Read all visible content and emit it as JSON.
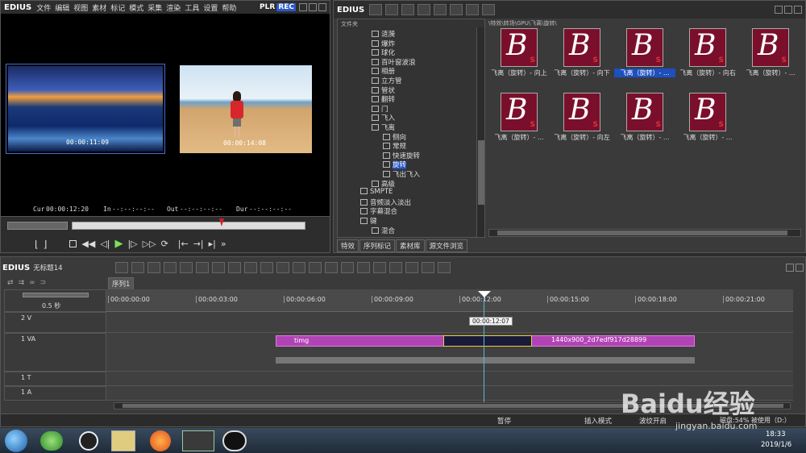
{
  "player": {
    "logo": "EDIUS",
    "menu": [
      "文件",
      "编辑",
      "视图",
      "素材",
      "标记",
      "模式",
      "采集",
      "渲染",
      "工具",
      "设置",
      "帮助"
    ],
    "plr": "PLR",
    "rec": "REC",
    "clip1_tc": "00:00:11:09",
    "clip2_tc": "00:00:14:08",
    "cur_label": "Cur",
    "cur_value": "00:00:12:20",
    "in_label": "In",
    "in_value": "--:--:--:--",
    "out_label": "Out",
    "out_value": "--:--:--:--",
    "dur_label": "Dur",
    "dur_value": "--:--:--:--"
  },
  "bin": {
    "logo": "EDIUS",
    "folder_header": "文件夹",
    "path": "\\特效\\转场\\GPU\\飞离\\旋转\\",
    "tree": [
      {
        "label": "涟漪",
        "indent": 1
      },
      {
        "label": "爆炸",
        "indent": 1
      },
      {
        "label": "球化",
        "indent": 1
      },
      {
        "label": "百叶窗波浪",
        "indent": 1
      },
      {
        "label": "相册",
        "indent": 1
      },
      {
        "label": "立方管",
        "indent": 1
      },
      {
        "label": "管状",
        "indent": 1
      },
      {
        "label": "翻转",
        "indent": 1
      },
      {
        "label": "门",
        "indent": 1
      },
      {
        "label": "飞入",
        "indent": 1
      },
      {
        "label": "飞离",
        "indent": 1
      },
      {
        "label": "侧向",
        "indent": 2
      },
      {
        "label": "常规",
        "indent": 2
      },
      {
        "label": "快速旋转",
        "indent": 2
      },
      {
        "label": "旋转",
        "indent": 2
      },
      {
        "label": "飞出飞入",
        "indent": 2
      },
      {
        "label": "高级",
        "indent": 1
      },
      {
        "label": "SMPTE",
        "indent": 0
      },
      {
        "label": "音频淡入淡出",
        "indent": 0
      },
      {
        "label": "字幕混合",
        "indent": 0
      },
      {
        "label": "键",
        "indent": 0
      },
      {
        "label": "混合",
        "indent": 1
      }
    ],
    "thumbs": [
      "飞离（旋转）- 向上",
      "飞离（旋转）- 向下",
      "飞离（旋转）- ...",
      "飞离（旋转）- 向右",
      "飞离（旋转）- ...",
      "飞离（旋转）- ...",
      "飞离（旋转）- 向左",
      "飞离（旋转）- ...",
      "飞离（旋转）- ..."
    ],
    "tabs": [
      "特效",
      "序列标记",
      "素材库",
      "源文件浏览"
    ]
  },
  "timeline": {
    "logo": "EDIUS",
    "project": "无标题14",
    "sequence_tab": "序列1",
    "scale": "0.5 秒",
    "ruler": [
      "00:00:00:00",
      "00:00:03:00",
      "00:00:06:00",
      "00:00:09:00",
      "00:00:12:00",
      "00:00:15:00",
      "00:00:18:00",
      "00:00:21:00"
    ],
    "cursor_tc": "00:00:12:07",
    "tracks": [
      "2 V",
      "1 VA",
      "1 T",
      "1 A"
    ],
    "clip1": "timg",
    "clip2": "1440x900_2d7edf917d28899"
  },
  "statusbar": {
    "pause": "暂停",
    "insert_mode": "插入模式",
    "ripple": "波纹开启",
    "disk": "磁盘:54% 被使用（D:）"
  },
  "taskbar": {
    "time": "18:33",
    "date": "2019/1/6"
  },
  "watermark": {
    "brand": "Baidu经验",
    "url": "jingyan.baidu.com"
  }
}
